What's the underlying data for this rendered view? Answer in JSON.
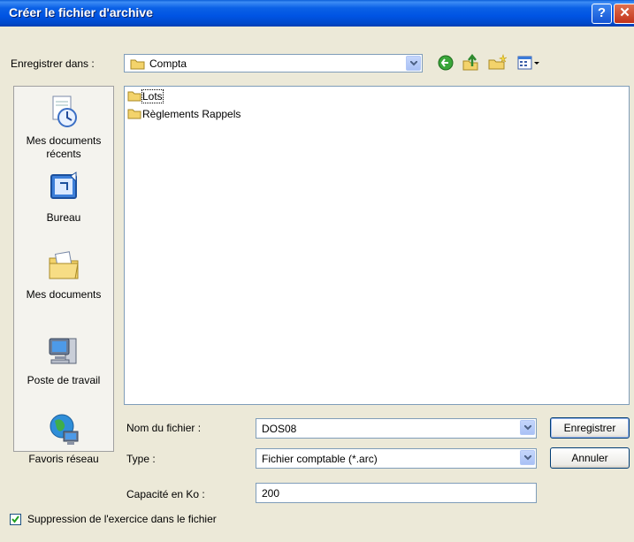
{
  "window": {
    "title": "Créer le fichier d'archive"
  },
  "titlebar": {
    "help_glyph": "?",
    "close_glyph": "✕"
  },
  "toolbar": {
    "save_in_label": "Enregistrer dans :",
    "save_in_value": "Compta",
    "icons": [
      "back-icon",
      "up-folder-icon",
      "new-folder-icon",
      "view-menu-icon"
    ]
  },
  "places": [
    {
      "label": "Mes documents récents",
      "icon": "recent-documents-icon"
    },
    {
      "label": "Bureau",
      "icon": "desktop-icon"
    },
    {
      "label": "Mes documents",
      "icon": "my-documents-icon"
    },
    {
      "label": "Poste de travail",
      "icon": "my-computer-icon"
    },
    {
      "label": "Favoris réseau",
      "icon": "network-places-icon"
    }
  ],
  "files": [
    {
      "name": "Lots",
      "icon": "folder-icon",
      "selected": true
    },
    {
      "name": "Règlements Rappels",
      "icon": "folder-icon",
      "selected": false
    }
  ],
  "form": {
    "filename_label": "Nom du fichier :",
    "filename_value": "DOS08",
    "type_label": "Type :",
    "type_value": "Fichier comptable (*.arc)",
    "capacity_label": "Capacité en Ko :",
    "capacity_value": "200",
    "checkbox_label": "Suppression de l'exercice dans le fichier",
    "checkbox_checked": true
  },
  "buttons": {
    "save": "Enregistrer",
    "cancel": "Annuler"
  },
  "colors": {
    "titlebar": "#0054e3",
    "dialog_bg": "#ece9d8",
    "folder_yellow": "#f3d36b",
    "border_blue": "#7f9db9"
  }
}
